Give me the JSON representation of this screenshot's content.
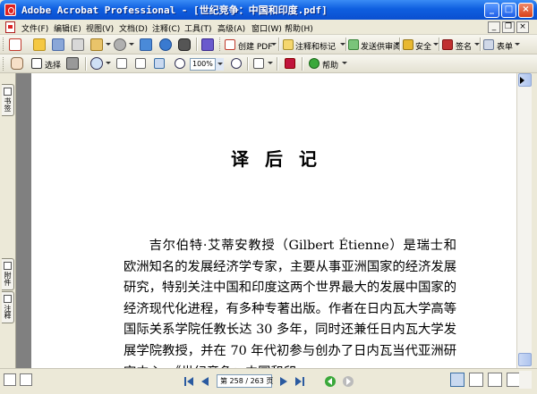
{
  "window": {
    "title": "Adobe Acrobat Professional - [世纪竞争：中国和印度.pdf]",
    "controls": {
      "minimize": "_",
      "maximize": "□",
      "close": "×"
    }
  },
  "menubar": {
    "items": [
      "文件(F)",
      "编辑(E)",
      "视图(V)",
      "文档(D)",
      "注释(C)",
      "工具(T)",
      "高级(A)",
      "窗口(W)",
      "帮助(H)"
    ],
    "doc_controls": {
      "minimize": "_",
      "restore": "❐",
      "close": "×"
    }
  },
  "toolbar1": {
    "create_pdf": "创建 PDF",
    "comment_markup": "注释和标记",
    "send_review": "发送供审阅",
    "secure": "安全",
    "sign": "签名",
    "forms": "表单"
  },
  "toolbar2": {
    "select": "选择",
    "zoom_value": "100%",
    "help": "帮助"
  },
  "left_pane": {
    "tabs": [
      "书签",
      "附件",
      "注释"
    ]
  },
  "document": {
    "heading": "译后记",
    "paragraph": "吉尔伯特·艾蒂安教授（Gilbert Étienne）是瑞士和欧洲知名的发展经济学专家，主要从事亚洲国家的经济发展研究，特别关注中国和印度这两个世界最大的发展中国家的经济现代化进程，有多种专著出版。作者在日内瓦大学高等国际关系学院任教长达 30 多年，同时还兼任日内瓦大学发展学院教授，并在 70 年代初参与创办了日内瓦当代亚洲研究中心。《世纪竞争：中国和印"
  },
  "statusbar": {
    "page_indicator": "第 258 / 263 页"
  },
  "colors": {
    "titlebar": "#0f5fe0",
    "chrome": "#ece9d8",
    "doc_background": "#808080",
    "page": "#ffffff"
  },
  "icons": {
    "toolbar1": [
      "create-pdf-icon",
      "open-folder-icon",
      "save-icon",
      "print-icon",
      "organizer-icon",
      "attach-icon",
      "email-icon",
      "search-icon",
      "stamp-icon"
    ],
    "toolbar2": [
      "hand-icon",
      "select-text-icon",
      "snapshot-icon",
      "zoom-icon",
      "actual-size-icon",
      "fit-page-icon",
      "fit-width-icon",
      "zoom-out-icon",
      "zoom-in-icon",
      "rotate-icon",
      "yahoo-icon",
      "help-icon"
    ],
    "status": [
      "first-page-icon",
      "previous-page-icon",
      "next-page-icon",
      "last-page-icon",
      "go-back-icon",
      "go-forward-icon"
    ]
  }
}
